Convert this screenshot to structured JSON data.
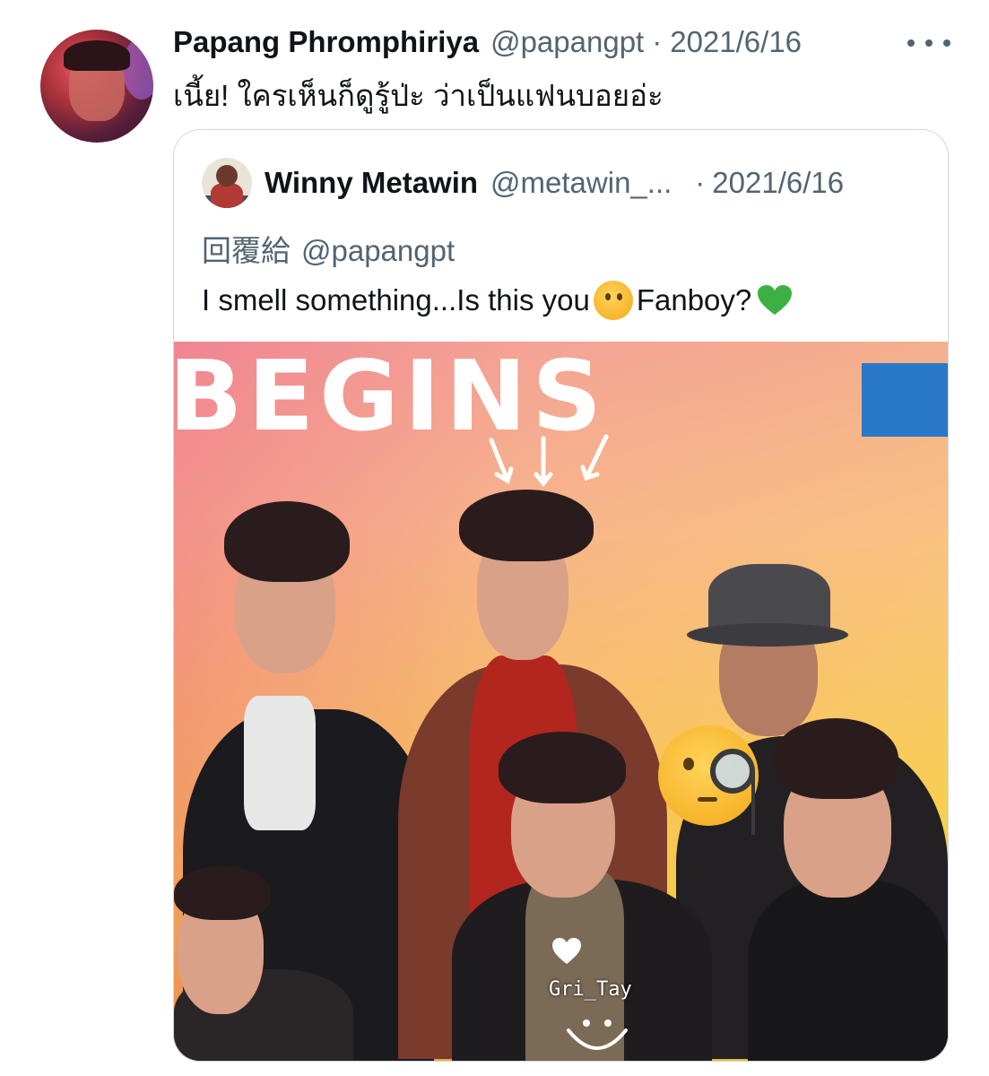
{
  "tweet": {
    "author_name": "Papang Phromphiriya",
    "author_handle": "@papangpt",
    "separator": "·",
    "date": "2021/6/16",
    "text": "เนี้ย! ใครเห็นก็ดูรู้ป่ะ ว่าเป็นแฟนบอยอ่ะ",
    "more_icon": "more-horizontal-icon"
  },
  "quote": {
    "author_name": "Winny Metawin",
    "author_handle": "@metawin_...",
    "separator": "·",
    "date": "2021/6/16",
    "reply_prefix": "回覆給",
    "reply_mention": "@papangpt",
    "text_part1": "I smell something...Is this you",
    "emoji1": "thinking-face-emoji",
    "text_part2": "Fanboy?",
    "emoji2": "green-heart-emoji"
  },
  "media": {
    "banner_text": "BEGINS",
    "watermark": "Gri_Tay",
    "sticker": "face-with-monocle-emoji"
  },
  "colors": {
    "secondary_text": "#536471",
    "primary_text": "#0f1419",
    "card_border": "#cfd9de",
    "green_heart": "#3cb043"
  }
}
